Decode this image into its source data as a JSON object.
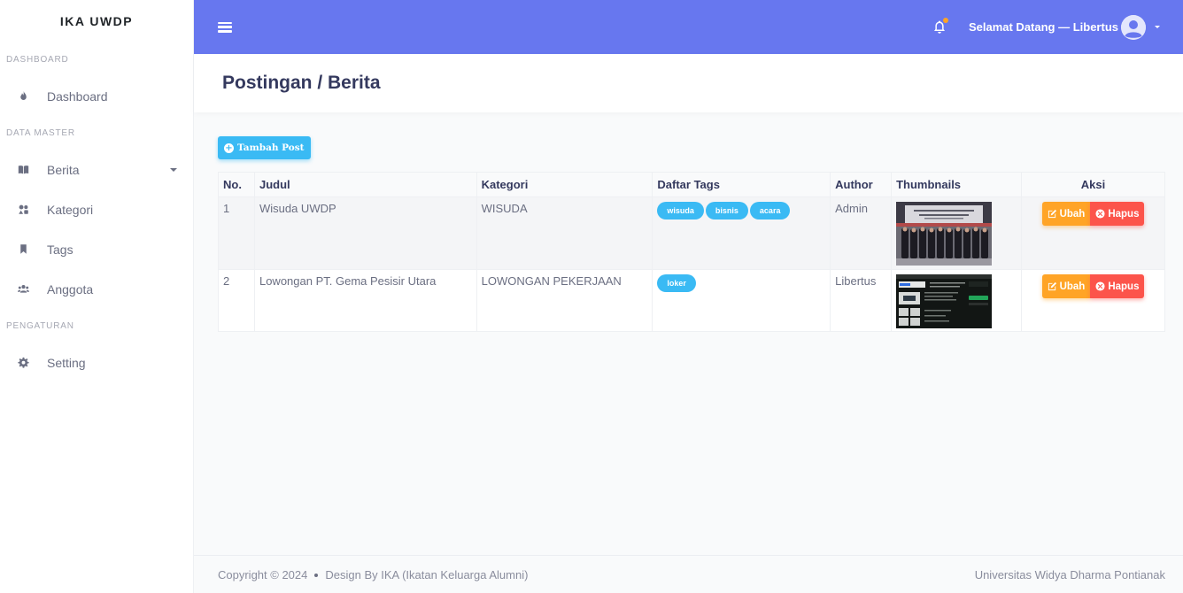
{
  "sidebar": {
    "brand": "IKA UWDP",
    "sections": {
      "dashboard": "DASHBOARD",
      "data_master": "DATA MASTER",
      "pengaturan": "PENGATURAN"
    },
    "items": {
      "dashboard": "Dashboard",
      "berita": "Berita",
      "kategori": "Kategori",
      "tags": "Tags",
      "anggota": "Anggota",
      "setting": "Setting"
    }
  },
  "navbar": {
    "user_greeting": "Selamat Datang — Libertus",
    "accent_color": "#6777ef",
    "notification_dot_color": "#ffa426"
  },
  "page": {
    "title": "Postingan / Berita",
    "add_button": "Tambah Post"
  },
  "table": {
    "headers": [
      "No.",
      "Judul",
      "Kategori",
      "Daftar Tags",
      "Author",
      "Thumbnails",
      "Aksi"
    ],
    "rows": [
      {
        "no": "1",
        "judul": "Wisuda UWDP",
        "kategori": "WISUDA",
        "tags": [
          "wisuda",
          "bisnis",
          "acara"
        ],
        "author": "Admin",
        "edit": "Ubah",
        "delete": "Hapus"
      },
      {
        "no": "2",
        "judul": "Lowongan PT. Gema Pesisir Utara",
        "kategori": "LOWONGAN PEKERJAAN",
        "tags": [
          "loker"
        ],
        "author": "Libertus",
        "edit": "Ubah",
        "delete": "Hapus"
      }
    ]
  },
  "footer": {
    "copyright": "Copyright © 2024",
    "design": "Design By IKA (Ikatan Keluarga Alumni)",
    "university": "Universitas Widya Dharma Pontianak"
  },
  "colors": {
    "tag": "#3abaf4",
    "edit": "#ffa426",
    "delete": "#fc544b"
  }
}
